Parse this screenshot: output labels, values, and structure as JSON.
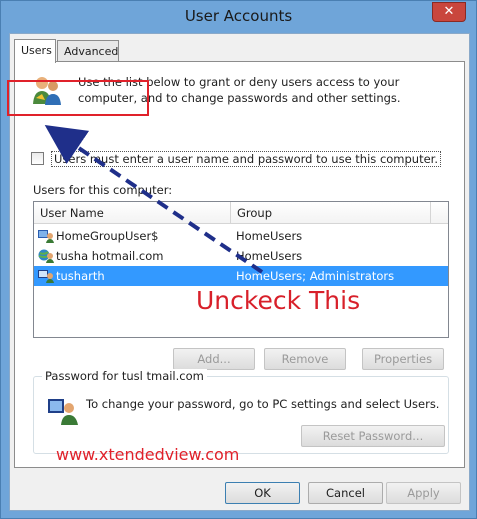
{
  "window": {
    "title": "User Accounts",
    "close_glyph": "✕"
  },
  "tabs": [
    {
      "label": "Users"
    },
    {
      "label": "Advanced"
    }
  ],
  "users_tab": {
    "intro_text": "Use the list below to grant or deny users access to your computer, and to change passwords and other settings.",
    "checkbox_label": "Users must enter a user name and password to use this computer.",
    "checkbox_checked": false,
    "list_label": "Users for this computer:",
    "columns": [
      "User Name",
      "Group"
    ],
    "rows": [
      {
        "name": "HomeGroupUser$",
        "group": "HomeUsers",
        "icon": "user-network-icon",
        "selected": false
      },
      {
        "name": "tusha                    hotmail.com",
        "group": "HomeUsers",
        "icon": "user-globe-icon",
        "selected": false
      },
      {
        "name": "tusharth",
        "group": "HomeUsers; Administrators",
        "icon": "user-network-icon",
        "selected": true
      }
    ],
    "buttons": {
      "add": "Add...",
      "remove": "Remove",
      "properties": "Properties"
    },
    "password_group": {
      "legend": "Password for tusl                        tmail.com",
      "text": "To change your password, go to PC settings and select Users.",
      "reset_button": "Reset Password..."
    }
  },
  "annotations": {
    "uncheck_text": "Unckeck This",
    "watermark": "www.xtendedview.com"
  },
  "dialog_buttons": {
    "ok": "OK",
    "cancel": "Cancel",
    "apply": "Apply"
  },
  "colors": {
    "selection": "#3399ff",
    "annotation_red": "#e0212a",
    "arrow_blue": "#1f2f8a"
  }
}
